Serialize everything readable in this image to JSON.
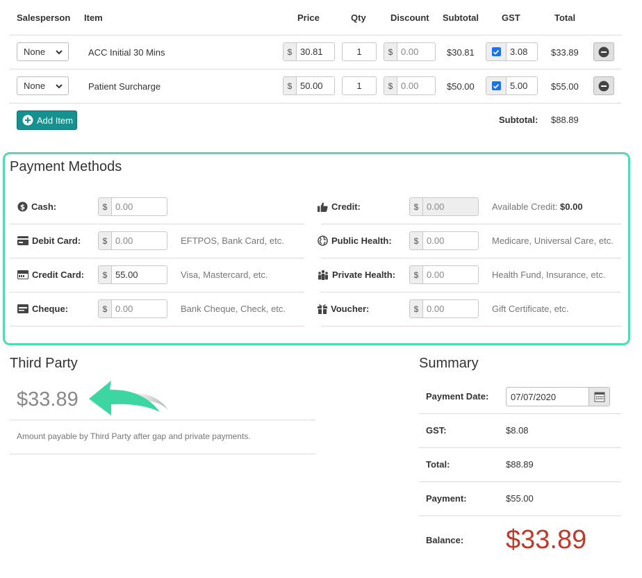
{
  "items_table": {
    "headers": {
      "salesperson": "Salesperson",
      "item": "Item",
      "price": "Price",
      "qty": "Qty",
      "discount": "Discount",
      "subtotal": "Subtotal",
      "gst": "GST",
      "total": "Total"
    },
    "currency_symbol": "$",
    "rows": [
      {
        "salesperson": "None",
        "item": "ACC Initial 30 Mins",
        "price": "30.81",
        "qty": "1",
        "discount": "0.00",
        "subtotal": "$30.81",
        "gst_checked": true,
        "gst": "3.08",
        "total": "$33.89"
      },
      {
        "salesperson": "None",
        "item": "Patient Surcharge",
        "price": "50.00",
        "qty": "1",
        "discount": "0.00",
        "subtotal": "$50.00",
        "gst_checked": true,
        "gst": "5.00",
        "total": "$55.00"
      }
    ],
    "add_item_label": "Add Item",
    "subtotal_label": "Subtotal:",
    "subtotal_value": "$88.89"
  },
  "payment_methods": {
    "title": "Payment Methods",
    "currency_symbol": "$",
    "methods": {
      "cash": {
        "label": "Cash:",
        "value": "0.00",
        "icon": "dollar-circle-icon"
      },
      "debit_card": {
        "label": "Debit Card:",
        "value": "0.00",
        "hint": "EFTPOS, Bank Card, etc.",
        "icon": "card-icon"
      },
      "credit_card": {
        "label": "Credit Card:",
        "value": "55.00",
        "hint": "Visa, Mastercard, etc.",
        "icon": "credit-card-icon"
      },
      "cheque": {
        "label": "Cheque:",
        "value": "0.00",
        "hint": "Bank Cheque, Check, etc.",
        "icon": "cheque-icon"
      },
      "credit": {
        "label": "Credit:",
        "value": "0.00",
        "hint_prefix": "Available Credit: ",
        "hint_value": "$0.00",
        "icon": "thumbs-up-icon"
      },
      "public_health": {
        "label": "Public Health:",
        "value": "0.00",
        "hint": "Medicare, Universal Care, etc.",
        "icon": "globe-icon"
      },
      "private_health": {
        "label": "Private Health:",
        "value": "0.00",
        "hint": "Health Fund, Insurance, etc.",
        "icon": "people-icon"
      },
      "voucher": {
        "label": "Voucher:",
        "value": "0.00",
        "hint": "Gift Certificate, etc.",
        "icon": "gift-icon"
      }
    }
  },
  "third_party": {
    "title": "Third Party",
    "amount": "$33.89",
    "note": "Amount payable by Third Party after gap and private payments."
  },
  "summary": {
    "title": "Summary",
    "payment_date_label": "Payment Date:",
    "payment_date": "07/07/2020",
    "gst_label": "GST:",
    "gst": "$8.08",
    "total_label": "Total:",
    "total": "$88.89",
    "payment_label": "Payment:",
    "payment": "$55.00",
    "balance_label": "Balance:",
    "balance": "$33.89"
  },
  "colors": {
    "highlight_border": "#4fdcb0",
    "arrow": "#3dd6a3",
    "add_button": "#17918f",
    "balance": "#c0392b",
    "checkbox": "#1a73e8"
  }
}
